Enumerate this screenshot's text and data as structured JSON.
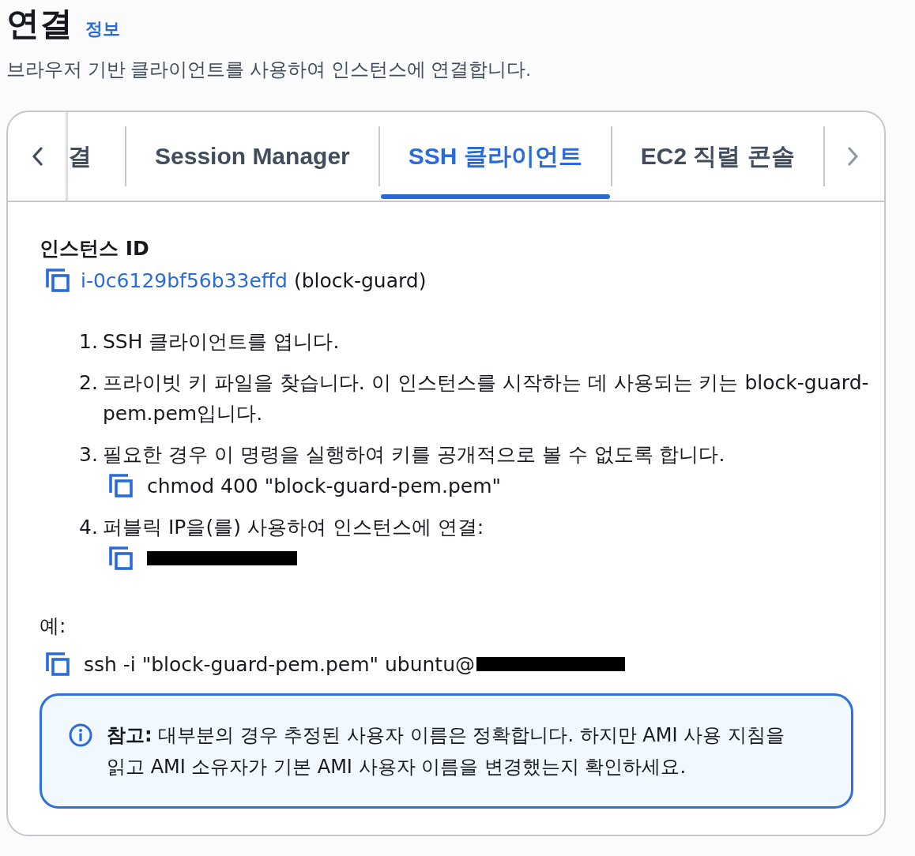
{
  "header": {
    "title": "연결",
    "info_link": "정보",
    "description": "브라우저 기반 클라이언트를 사용하여 인스턴스에 연결합니다."
  },
  "tabs": {
    "scroll_left": {
      "disabled": false
    },
    "scroll_right": {
      "disabled": true
    },
    "items": [
      {
        "label": "결",
        "selected": false,
        "clipped": true
      },
      {
        "label": "Session Manager",
        "selected": false,
        "clipped": false
      },
      {
        "label": "SSH 클라이언트",
        "selected": true,
        "clipped": false
      },
      {
        "label": "EC2 직렬 콘솔",
        "selected": false,
        "clipped": false
      }
    ]
  },
  "instance": {
    "label": "인스턴스 ID",
    "id": "i-0c6129bf56b33effd",
    "name": "(block-guard)"
  },
  "steps": [
    {
      "number": "1.",
      "text": "SSH 클라이언트를 엽니다."
    },
    {
      "number": "2.",
      "text": "프라이빗 키 파일을 찾습니다. 이 인스턴스를 시작하는 데 사용되는 키는 block-guard-pem.pem입니다."
    },
    {
      "number": "3.",
      "text": "필요한 경우 이 명령을 실행하여 키를 공개적으로 볼 수 없도록 합니다.",
      "command": {
        "text": "chmod 400 \"block-guard-pem.pem\""
      }
    },
    {
      "number": "4.",
      "text": "퍼블릭 IP을(를) 사용하여 인스턴스에 연결:",
      "command": {
        "redacted": true
      }
    }
  ],
  "example": {
    "label": "예:",
    "command": {
      "text": "ssh -i \"block-guard-pem.pem\" ubuntu@",
      "redacted": true
    }
  },
  "note": {
    "text": "**참고:** 대부분의 경우 추정된 사용자 이름은 정확합니다. 하지만 AMI 사용 지침을 읽고 AMI 소유자가 기본 AMI 사용자 이름을 변경했는지 확인하세요."
  }
}
